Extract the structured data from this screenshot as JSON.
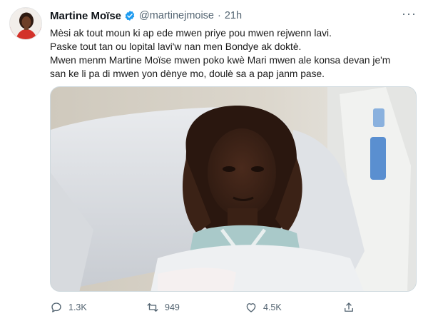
{
  "tweet": {
    "author_name": "Martine Moïse",
    "handle": "@martinejmoise",
    "separator": "·",
    "time": "21h",
    "more_label": "···",
    "lines": [
      "Mèsi ak tout moun ki ap ede mwen priye pou mwen rejwenn lavi.",
      "Paske tout tan ou lopital lavi'w nan men Bondye ak doktè.",
      "Mwen menm Martine Moïse mwen  poko kwè Mari mwen ale konsa devan je'm",
      "san ke li pa di mwen yon dènye mo, doulè sa a pap janm pase."
    ]
  },
  "actions": {
    "reply_count": "1.3K",
    "retweet_count": "949",
    "like_count": "4.5K"
  },
  "colors": {
    "verified_badge": "#1d9bf0",
    "secondary_text": "#536471",
    "border": "#cfd9de"
  },
  "icons": [
    "verified-badge-icon",
    "more-icon",
    "reply-icon",
    "retweet-icon",
    "like-icon",
    "share-icon"
  ]
}
